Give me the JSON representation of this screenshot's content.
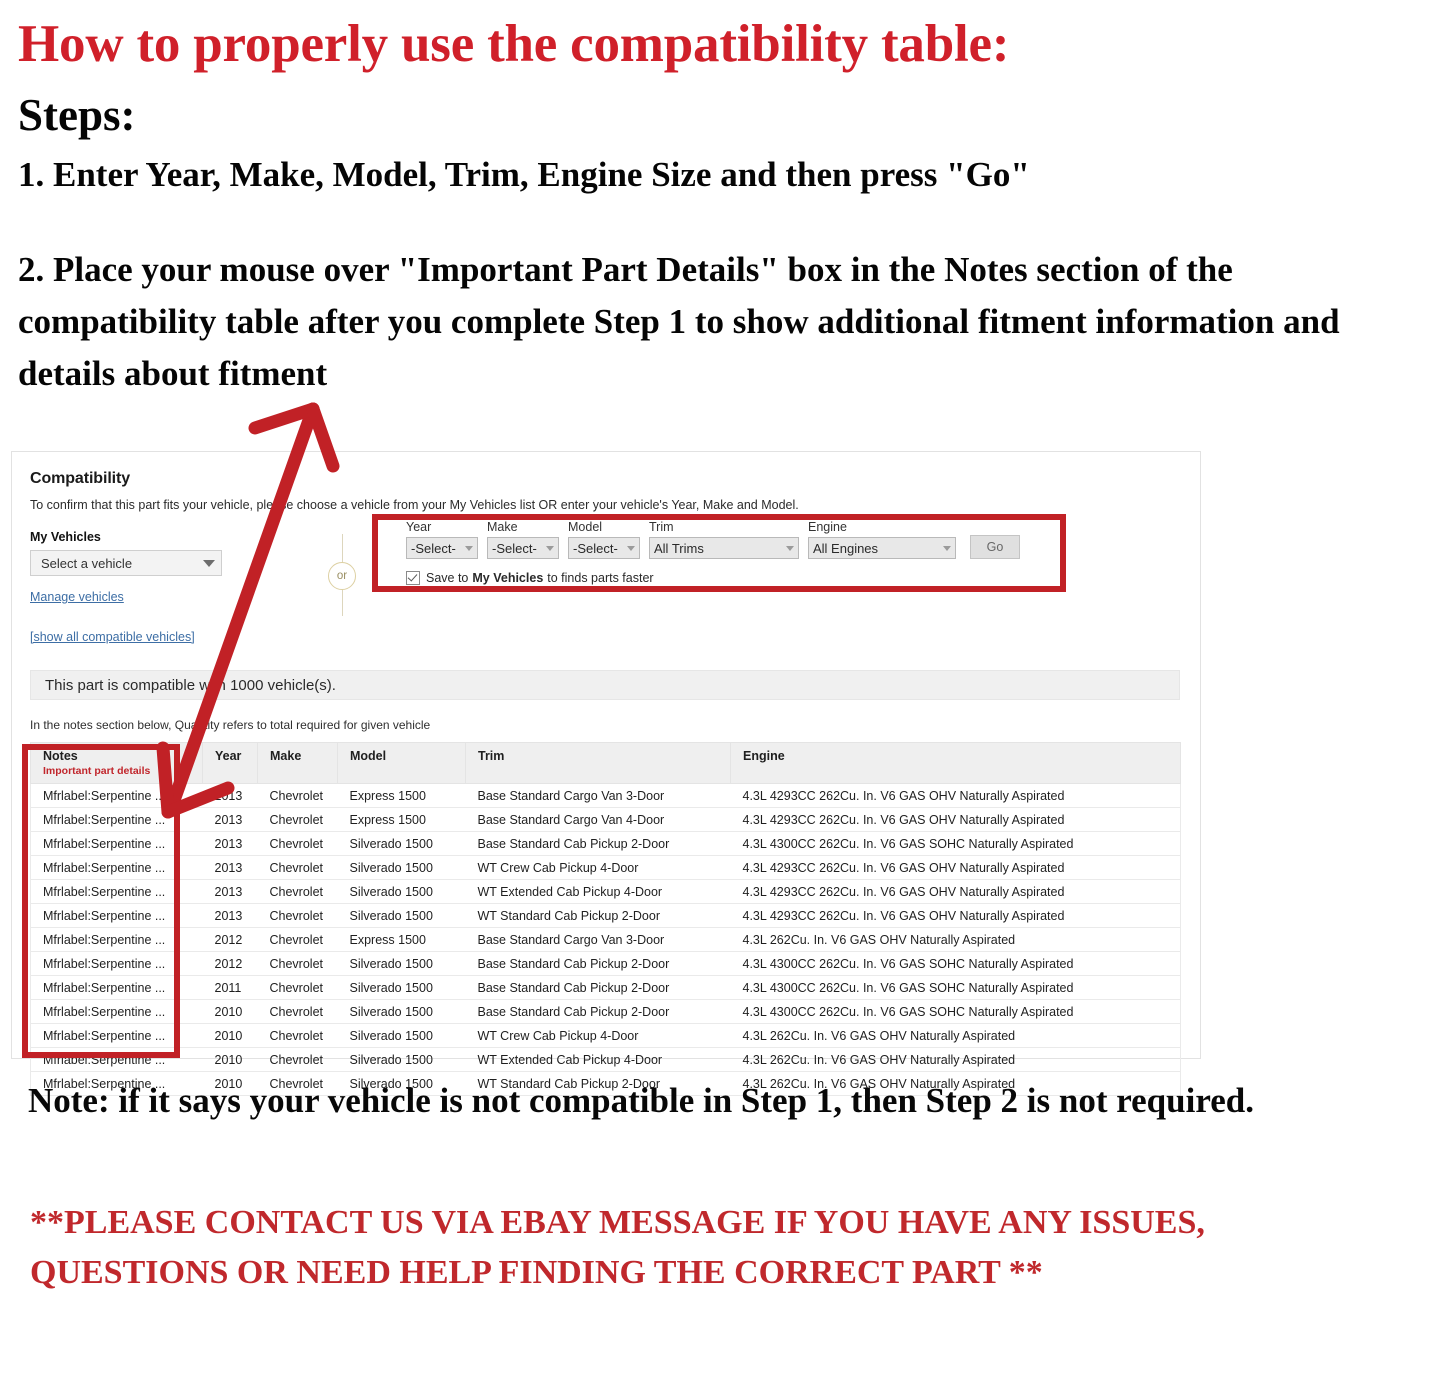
{
  "headings": {
    "title": "How to properly use the compatibility table:",
    "steps_label": "Steps:",
    "step1": "1. Enter Year, Make, Model, Trim, Engine Size and then press \"Go\"",
    "step2": "2. Place your mouse over \"Important Part Details\" box in the Notes section of the compatibility table after you complete Step 1 to show additional fitment information and details about fitment"
  },
  "compatibility": {
    "heading": "Compatibility",
    "subtitle": "To confirm that this part fits your vehicle, please choose a vehicle from your My Vehicles list OR enter your vehicle's Year, Make and Model.",
    "my_vehicles_label": "My Vehicles",
    "vehicle_select_value": "Select a vehicle",
    "manage_vehicles_link": "Manage vehicles",
    "show_all_link": "[show all compatible vehicles]",
    "or_label": "or",
    "finder": {
      "year_label": "Year",
      "year_value": "-Select-",
      "make_label": "Make",
      "make_value": "-Select-",
      "model_label": "Model",
      "model_value": "-Select-",
      "trim_label": "Trim",
      "trim_value": "All Trims",
      "engine_label": "Engine",
      "engine_value": "All Engines",
      "go_label": "Go",
      "save_text_pre": "Save to",
      "save_text_bold": "My Vehicles",
      "save_text_post": "to finds parts faster"
    },
    "compat_banner": "This part is compatible with 1000 vehicle(s).",
    "notes_hint": "In the notes section below, Quantity refers to total required for given vehicle"
  },
  "table": {
    "headers": {
      "notes": "Notes",
      "notes_sub": "Important part details",
      "year": "Year",
      "make": "Make",
      "model": "Model",
      "trim": "Trim",
      "engine": "Engine"
    },
    "rows": [
      {
        "notes": "Mfrlabel:Serpentine ...",
        "year": "2013",
        "make": "Chevrolet",
        "model": "Express 1500",
        "trim": "Base Standard Cargo Van 3-Door",
        "engine": "4.3L 4293CC 262Cu. In. V6 GAS OHV Naturally Aspirated"
      },
      {
        "notes": "Mfrlabel:Serpentine ...",
        "year": "2013",
        "make": "Chevrolet",
        "model": "Express 1500",
        "trim": "Base Standard Cargo Van 4-Door",
        "engine": "4.3L 4293CC 262Cu. In. V6 GAS OHV Naturally Aspirated"
      },
      {
        "notes": "Mfrlabel:Serpentine ...",
        "year": "2013",
        "make": "Chevrolet",
        "model": "Silverado 1500",
        "trim": "Base Standard Cab Pickup 2-Door",
        "engine": "4.3L 4300CC 262Cu. In. V6 GAS SOHC Naturally Aspirated"
      },
      {
        "notes": "Mfrlabel:Serpentine ...",
        "year": "2013",
        "make": "Chevrolet",
        "model": "Silverado 1500",
        "trim": "WT Crew Cab Pickup 4-Door",
        "engine": "4.3L 4293CC 262Cu. In. V6 GAS OHV Naturally Aspirated"
      },
      {
        "notes": "Mfrlabel:Serpentine ...",
        "year": "2013",
        "make": "Chevrolet",
        "model": "Silverado 1500",
        "trim": "WT Extended Cab Pickup 4-Door",
        "engine": "4.3L 4293CC 262Cu. In. V6 GAS OHV Naturally Aspirated"
      },
      {
        "notes": "Mfrlabel:Serpentine ...",
        "year": "2013",
        "make": "Chevrolet",
        "model": "Silverado 1500",
        "trim": "WT Standard Cab Pickup 2-Door",
        "engine": "4.3L 4293CC 262Cu. In. V6 GAS OHV Naturally Aspirated"
      },
      {
        "notes": "Mfrlabel:Serpentine ...",
        "year": "2012",
        "make": "Chevrolet",
        "model": "Express 1500",
        "trim": "Base Standard Cargo Van 3-Door",
        "engine": "4.3L 262Cu. In. V6 GAS OHV Naturally Aspirated"
      },
      {
        "notes": "Mfrlabel:Serpentine ...",
        "year": "2012",
        "make": "Chevrolet",
        "model": "Silverado 1500",
        "trim": "Base Standard Cab Pickup 2-Door",
        "engine": "4.3L 4300CC 262Cu. In. V6 GAS SOHC Naturally Aspirated"
      },
      {
        "notes": "Mfrlabel:Serpentine ...",
        "year": "2011",
        "make": "Chevrolet",
        "model": "Silverado 1500",
        "trim": "Base Standard Cab Pickup 2-Door",
        "engine": "4.3L 4300CC 262Cu. In. V6 GAS SOHC Naturally Aspirated"
      },
      {
        "notes": "Mfrlabel:Serpentine ...",
        "year": "2010",
        "make": "Chevrolet",
        "model": "Silverado 1500",
        "trim": "Base Standard Cab Pickup 2-Door",
        "engine": "4.3L 4300CC 262Cu. In. V6 GAS SOHC Naturally Aspirated"
      },
      {
        "notes": "Mfrlabel:Serpentine ...",
        "year": "2010",
        "make": "Chevrolet",
        "model": "Silverado 1500",
        "trim": "WT Crew Cab Pickup 4-Door",
        "engine": "4.3L 262Cu. In. V6 GAS OHV Naturally Aspirated"
      },
      {
        "notes": "Mfrlabel:Serpentine ...",
        "year": "2010",
        "make": "Chevrolet",
        "model": "Silverado 1500",
        "trim": "WT Extended Cab Pickup 4-Door",
        "engine": "4.3L 262Cu. In. V6 GAS OHV Naturally Aspirated"
      },
      {
        "notes": "Mfrlabel:Serpentine ...",
        "year": "2010",
        "make": "Chevrolet",
        "model": "Silverado 1500",
        "trim": "WT Standard Cab Pickup 2-Door",
        "engine": "4.3L 262Cu. In. V6 GAS OHV Naturally Aspirated"
      }
    ]
  },
  "footer": {
    "note": "Note: if it says your vehicle is not compatible in Step 1, then Step 2 is not required.",
    "contact": "**PLEASE CONTACT US VIA EBAY MESSAGE IF YOU HAVE ANY ISSUES, QUESTIONS OR NEED HELP FINDING THE CORRECT PART **"
  },
  "colors": {
    "accent_red": "#D0202A",
    "annotation_red": "#C12126",
    "link_blue": "#3d6ea5"
  }
}
